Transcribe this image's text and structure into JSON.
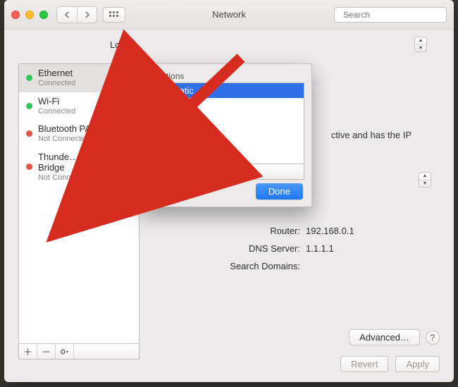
{
  "window": {
    "title": "Network",
    "search_placeholder": "Search"
  },
  "location": {
    "label": "Lo",
    "stepper_up": "▲",
    "stepper_down": "▼"
  },
  "sidebar": {
    "services": [
      {
        "name": "Ethernet",
        "status": "Connected",
        "dot": "green",
        "pill": "gray"
      },
      {
        "name": "Wi-Fi",
        "status": "Connected",
        "dot": "green",
        "pill": "blue"
      },
      {
        "name": "Bluetooth PAN",
        "status": "Not Connected",
        "dot": "red",
        "pill": "blue"
      },
      {
        "name": "Thunde…lt Bridge",
        "status": "Not Connected",
        "dot": "red",
        "pill": "gray"
      }
    ],
    "btn_add": "＋",
    "btn_remove": "－",
    "btn_gear": "✻▾"
  },
  "main": {
    "hint_fragment": "ctive and has the IP",
    "rows": [
      {
        "label": "Router:",
        "value": "192.168.0.1"
      },
      {
        "label": "DNS Server:",
        "value": "1.1.1.1"
      },
      {
        "label": "Search Domains:",
        "value": ""
      }
    ],
    "advanced": "Advanced…",
    "help": "?",
    "revert": "Revert",
    "apply": "Apply"
  },
  "sheet": {
    "label": "Locations",
    "items": [
      {
        "name": "Automatic",
        "selected": true
      }
    ],
    "btn_add": "＋",
    "btn_remove": "－",
    "btn_gear": "✻▾",
    "done": "Done"
  },
  "colors": {
    "accent_blue": "#2f6fe8",
    "arrow_red": "#d62b1f"
  }
}
